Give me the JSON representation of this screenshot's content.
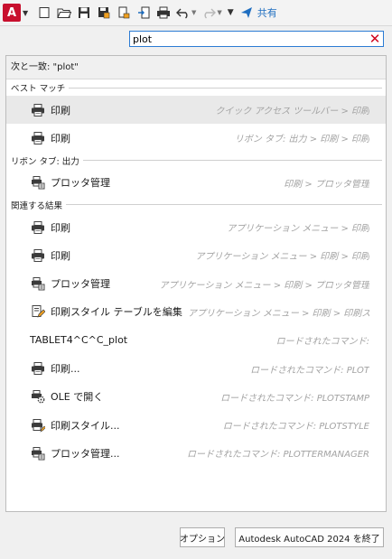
{
  "toolbar": {
    "app_letter": "A",
    "share_label": "共有"
  },
  "search": {
    "value": "plot"
  },
  "match_header": "次と一致: \"plot\"",
  "sections": {
    "best": "ベスト マッチ",
    "ribbon": "リボン タブ: 出力",
    "related": "関連する結果"
  },
  "best": [
    {
      "label": "印刷",
      "path": "クイック アクセス ツールバー > 印刷",
      "icon": "printer-icon"
    },
    {
      "label": "印刷",
      "path": "リボン タブ: 出力 > 印刷 > 印刷",
      "icon": "printer-icon"
    }
  ],
  "ribbon": [
    {
      "label": "プロッタ管理",
      "path": "印刷 > プロッタ管理",
      "icon": "plotter-manager-icon"
    }
  ],
  "related": [
    {
      "label": "印刷",
      "path": "アプリケーション メニュー > 印刷",
      "icon": "printer-icon"
    },
    {
      "label": "印刷",
      "path": "アプリケーション メニュー > 印刷 > 印刷",
      "icon": "printer-icon"
    },
    {
      "label": "プロッタ管理",
      "path": "アプリケーション メニュー > 印刷 > プロッタ管理",
      "icon": "plotter-manager-icon"
    },
    {
      "label": "印刷スタイル テーブルを編集",
      "path": "アプリケーション メニュー > 印刷 > 印刷スタイ...",
      "icon": "plot-style-edit-icon"
    },
    {
      "label": "TABLET4^C^C_plot",
      "path": "ロードされたコマンド:",
      "icon": ""
    },
    {
      "label": "印刷...",
      "path": "ロードされたコマンド: PLOT",
      "icon": "printer-icon"
    },
    {
      "label": "OLE で開く",
      "path": "ロードされたコマンド: PLOTSTAMP",
      "icon": "ole-gear-icon"
    },
    {
      "label": "印刷スタイル...",
      "path": "ロードされたコマンド: PLOTSTYLE",
      "icon": "plot-style-icon"
    },
    {
      "label": "プロッタ管理...",
      "path": "ロードされたコマンド: PLOTTERMANAGER",
      "icon": "plotter-manager-icon"
    }
  ],
  "buttons": {
    "options": "オプション",
    "exit": "Autodesk AutoCAD 2024 を終了"
  },
  "colors": {
    "accent": "#1e6ec0",
    "app_red": "#c8102e",
    "clear_red": "#d0021b"
  }
}
